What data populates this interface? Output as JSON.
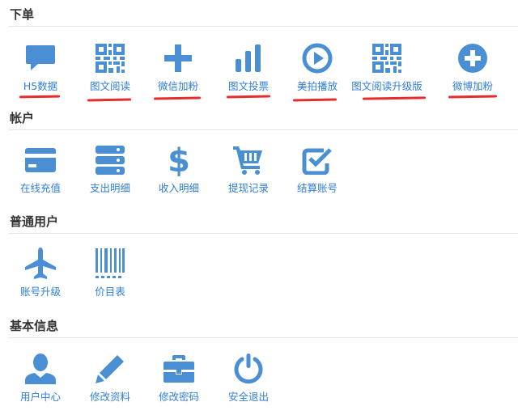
{
  "colors": {
    "icon": "#4a8fd4",
    "label": "#2f7ed8",
    "underline": "#e52d2d"
  },
  "sections": [
    {
      "title": "下单",
      "items": [
        {
          "label": "H5数据",
          "icon": "chat-bubble-icon",
          "underlined": true
        },
        {
          "label": "图文阅读",
          "icon": "qr-code-icon",
          "underlined": true
        },
        {
          "label": "微信加粉",
          "icon": "plus-icon",
          "underlined": true
        },
        {
          "label": "图文投票",
          "icon": "bar-chart-icon",
          "underlined": true
        },
        {
          "label": "美拍播放",
          "icon": "play-circle-icon",
          "underlined": true
        },
        {
          "label": "图文阅读升级版",
          "icon": "qr-code-icon",
          "underlined": true
        },
        {
          "label": "微博加粉",
          "icon": "plus-circle-icon",
          "underlined": true
        }
      ]
    },
    {
      "title": "帐户",
      "items": [
        {
          "label": "在线充值",
          "icon": "credit-card-icon"
        },
        {
          "label": "支出明细",
          "icon": "server-stack-icon"
        },
        {
          "label": "收入明细",
          "icon": "dollar-icon"
        },
        {
          "label": "提现记录",
          "icon": "cart-icon"
        },
        {
          "label": "结算账号",
          "icon": "check-square-icon"
        }
      ]
    },
    {
      "title": "普通用户",
      "items": [
        {
          "label": "账号升级",
          "icon": "airplane-icon"
        },
        {
          "label": "价目表",
          "icon": "barcode-icon"
        }
      ]
    },
    {
      "title": "基本信息",
      "items": [
        {
          "label": "用户中心",
          "icon": "user-icon"
        },
        {
          "label": "修改资料",
          "icon": "pencil-icon"
        },
        {
          "label": "修改密码",
          "icon": "briefcase-icon"
        },
        {
          "label": "安全退出",
          "icon": "power-icon"
        }
      ]
    }
  ]
}
